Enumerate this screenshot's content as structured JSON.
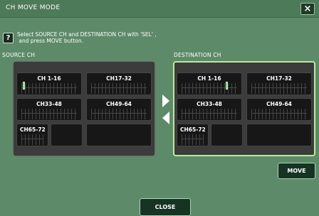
{
  "window": {
    "title": "CH MOVE MODE",
    "close_symbol": "×"
  },
  "help": {
    "icon_text": "?",
    "text": "Select SOURCE CH and DESTINATION CH with 'SEL' ,\n and press MOVE button."
  },
  "source": {
    "label": "SOURCE CH",
    "groups": [
      {
        "label": "CH 1-16",
        "selected_channel": 1
      },
      {
        "label": "CH17-32"
      },
      {
        "label": "CH33-48"
      },
      {
        "label": "CH49-64"
      },
      {
        "label": "CH65-72"
      }
    ]
  },
  "destination": {
    "label": "DESTINATION CH",
    "groups": [
      {
        "label": "CH 1-16",
        "selected_channel": 10
      },
      {
        "label": "CH17-32"
      },
      {
        "label": "CH33-48"
      },
      {
        "label": "CH49-64"
      },
      {
        "label": "CH65-72"
      }
    ]
  },
  "buttons": {
    "move": "MOVE",
    "close": "CLOSE"
  },
  "colors": {
    "background": "#5d8a68",
    "selected_indicator": "#37d24b",
    "destination_frame": "#b9ec9a"
  },
  "icons": {
    "right_arrow": "right-arrow-icon",
    "left_arrow": "left-arrow-icon"
  }
}
